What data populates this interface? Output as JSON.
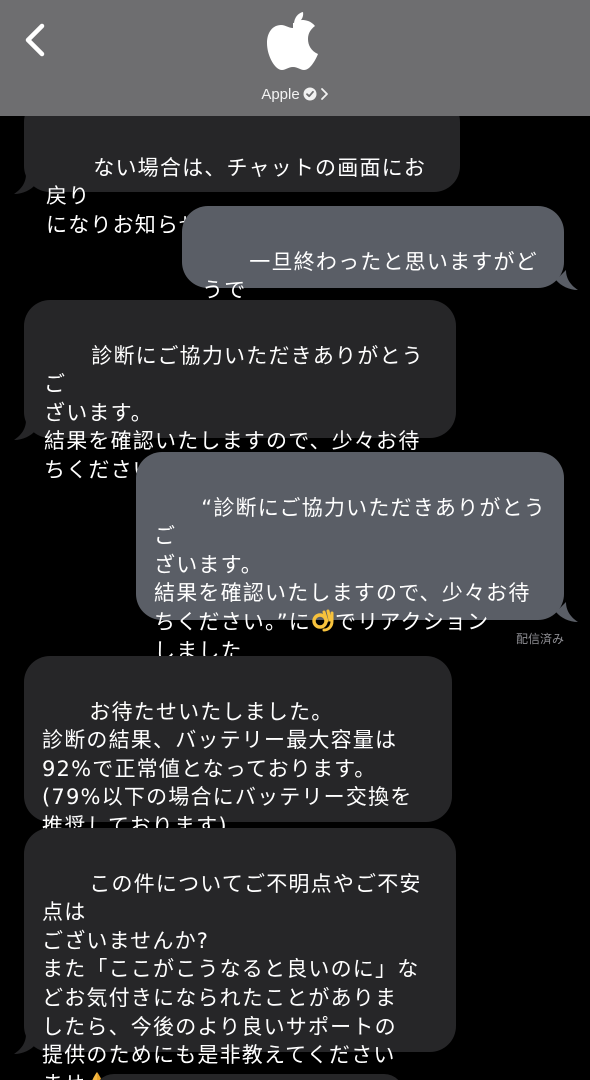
{
  "header": {
    "contact_name": "Apple",
    "back_icon": "chevron-left-icon",
    "logo_icon": "apple-logo-icon",
    "verified_icon": "verified-badge-icon",
    "chevron_icon": "chevron-right-icon"
  },
  "messages": [
    {
      "side": "in",
      "text": "ない場合は、チャットの画面にお戻り\nになりお知らせください。"
    },
    {
      "side": "out",
      "text": "一旦終わったと思いますがどうで\nしょうか。"
    },
    {
      "side": "in",
      "text": "診断にご協力いただきありがとうご\nざいます。\n結果を確認いたしますので、少々お待\nちください。"
    },
    {
      "side": "out",
      "text_before": "“診断にご協力いただきありがとうご\nざいます。\n結果を確認いたしますので、少々お待\nちください。”に",
      "emoji": "ok-hand-emoji",
      "text_after": "でリアクション\nしました"
    },
    {
      "side": "in",
      "text": "お待たせいたしました。\n診断の結果、バッテリー最大容量は\n92%で正常値となっております。\n(79%以下の場合にバッテリー交換を\n推奨しております)"
    },
    {
      "side": "in",
      "text": "この件についてご不明点やご不安点は\nございませんか?\nまた「ここがこうなると良いのに」な\nどお気付きになられたことがありま\nしたら、今後のより良いサポートの\n提供のためにも是非教えてください\nませ",
      "emoji": "folded-hands-emoji"
    }
  ],
  "status": {
    "delivered": "配信済み"
  },
  "colors": {
    "header_bg": "#6e6e70",
    "incoming_bubble": "#262628",
    "outgoing_bubble": "#5a5e66",
    "background": "#000000"
  }
}
